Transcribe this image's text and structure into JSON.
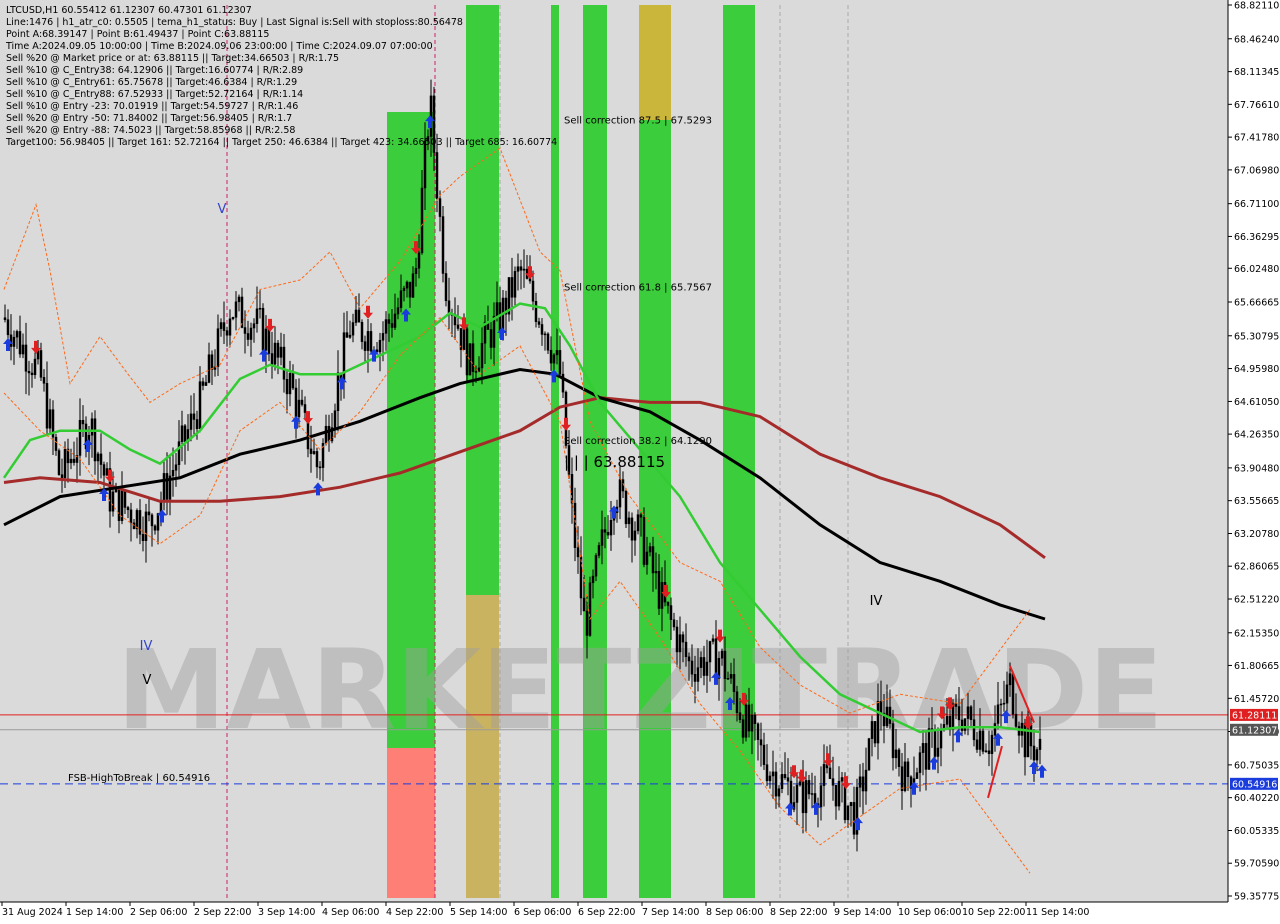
{
  "chart_data": {
    "type": "candlestick",
    "symbol": "LTCUSD,H1",
    "header_line": "LTCUSD,H1  60.55412 61.12307 60.47301 61.12307",
    "ohlc_last": {
      "open": 60.55412,
      "high": 61.12307,
      "low": 60.47301,
      "close": 61.12307
    },
    "info_lines": [
      "Line:1476 | h1_atr_c0: 0.5505 | tema_h1_status: Buy | Last Signal is:Sell with stoploss:80.56478",
      "Point A:68.39147 | Point B:61.49437 | Point C:63.88115",
      "Time A:2024.09.05 10:00:00 | Time B:2024.09.06 23:00:00 | Time C:2024.09.07 07:00:00",
      "Sell %20 @ Market price or at: 63.88115 || Target:34.66503 | R/R:1.75",
      "Sell %10 @ C_Entry38: 64.12906 || Target:16.60774 | R/R:2.89",
      "Sell %10 @ C_Entry61: 65.75678 || Target:46.6384 | R/R:1.29",
      "Sell %10 @ C_Entry88: 67.52933 || Target:52.72164 | R/R:1.14",
      "Sell %10 @ Entry -23: 70.01919 || Target:54.59727 | R/R:1.46",
      "Sell %20 @ Entry -50: 71.84002 || Target:56.98405 | R/R:1.7",
      "Sell %20 @ Entry -88: 74.5023 || Target:58.85968 || R/R:2.58",
      "Target100: 56.98405 || Target 161: 52.72164 || Target 250: 46.6384 || Target 423: 34.66503 || Target 685: 16.60774"
    ],
    "y_ticks": [
      "68.82110",
      "68.46240",
      "68.11345",
      "67.76610",
      "67.41780",
      "67.06980",
      "66.71100",
      "66.36295",
      "66.02480",
      "65.66665",
      "65.30795",
      "64.95980",
      "64.61050",
      "64.26350",
      "63.90480",
      "63.55665",
      "63.20780",
      "62.86065",
      "62.51220",
      "62.15350",
      "61.80665",
      "61.45720",
      "61.10500",
      "60.75035",
      "60.40220",
      "60.05335",
      "59.70590",
      "59.35775"
    ],
    "x_ticks": [
      "31 Aug 2024",
      "1 Sep 14:00",
      "2 Sep 06:00",
      "2 Sep 22:00",
      "3 Sep 14:00",
      "4 Sep 06:00",
      "4 Sep 22:00",
      "5 Sep 14:00",
      "6 Sep 06:00",
      "6 Sep 22:00",
      "7 Sep 14:00",
      "8 Sep 06:00",
      "8 Sep 22:00",
      "9 Sep 14:00",
      "10 Sep 06:00",
      "10 Sep 22:00",
      "11 Sep 14:00"
    ],
    "y_range": [
      59.35775,
      68.8211
    ],
    "price_labels": [
      {
        "value": 61.28111,
        "text": "61.28111",
        "color": "#e02020"
      },
      {
        "value": 61.12307,
        "text": "61.12307",
        "color": "#555555"
      },
      {
        "value": 60.54916,
        "text": "60.54916",
        "color": "#1a3cdd"
      }
    ],
    "hlines": [
      {
        "value": 61.28111,
        "color": "#e02020",
        "style": "solid"
      },
      {
        "value": 61.12307,
        "color": "#9a9a9a",
        "style": "solid"
      },
      {
        "value": 60.54916,
        "color": "#1a3cdd",
        "style": "dashed"
      }
    ],
    "annotations": [
      {
        "text": "Sell correction 87.5 | 67.5293",
        "value": 67.5293
      },
      {
        "text": "Sell correction 61.8 | 65.7567",
        "value": 65.7567
      },
      {
        "text": "Sell correction 38.2 | 64.1290",
        "value": 64.129
      },
      {
        "text": "| | | 63.88115",
        "value": 63.88115
      },
      {
        "text": "FSB-HighToBreak | 60.54916",
        "value": 60.54916
      }
    ],
    "wave_labels": [
      "V",
      "IV",
      "V",
      "IV"
    ],
    "watermark": "MARKETZITRADE",
    "series": [
      {
        "kind": "moving_average",
        "color": "#000000"
      },
      {
        "kind": "moving_average",
        "color": "#a52a2a"
      },
      {
        "kind": "moving_average",
        "color": "#33cc33"
      }
    ]
  },
  "colors": {
    "green_band": "#33cc33",
    "light_green_band": "#66dd33",
    "olive_band": "#c8b432",
    "red_band": "#ff7a70",
    "buy_arrow": "#1a3cdd",
    "sell_arrow": "#e02020"
  }
}
